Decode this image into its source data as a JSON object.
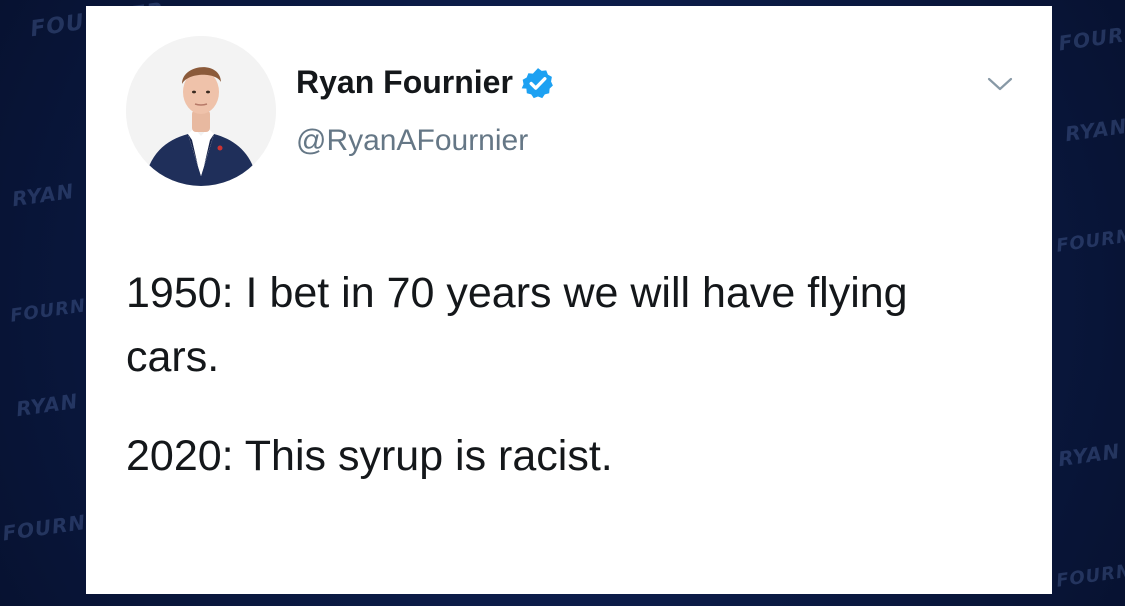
{
  "tweet": {
    "author_name": "Ryan Fournier",
    "handle": "@RyanAFournier",
    "verified": true,
    "lines": [
      "1950: I bet in 70 years we will have flying cars.",
      "2020: This syrup is racist."
    ]
  },
  "watermark": {
    "text_a": "RYAN",
    "text_b": "FOURNIER"
  },
  "colors": {
    "verified_badge": "#1da1f2",
    "name_text": "#14171a",
    "handle_text": "#657786",
    "background": "#0c1a3f"
  },
  "icons": {
    "verified": "verified-badge-icon",
    "menu": "chevron-down-icon"
  }
}
